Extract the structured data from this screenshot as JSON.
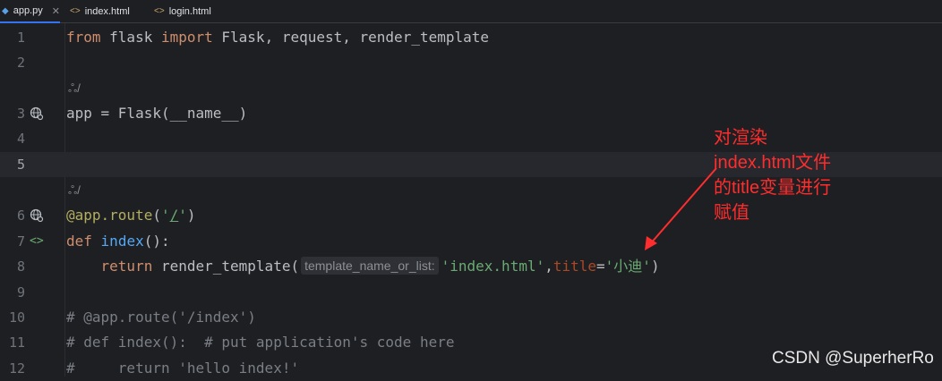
{
  "tabs": [
    {
      "label": "app.py",
      "icon": "python-file-icon",
      "active": true
    },
    {
      "label": "index.html",
      "icon": "html-file-icon"
    },
    {
      "label": "login.html",
      "icon": "html-file-icon"
    }
  ],
  "editor": {
    "lines": {
      "l1": {
        "num": "1",
        "code": "from flask import Flask, request, render_template"
      },
      "l2": {
        "num": "2"
      },
      "lens1": "ஃ/",
      "l3": {
        "num": "3",
        "code": "app = Flask(__name__)"
      },
      "l4": {
        "num": "4"
      },
      "l5": {
        "num": "5"
      },
      "lens2": "ஃ/",
      "l6": {
        "num": "6",
        "code": "@app.route('/')"
      },
      "l7": {
        "num": "7",
        "code": "def index():"
      },
      "l8": {
        "num": "8",
        "hint": "template_name_or_list:",
        "code": "return render_template('index.html',title='小迪')"
      },
      "l9": {
        "num": "9"
      },
      "l10": {
        "num": "10",
        "code": "# @app.route('/index')"
      },
      "l11": {
        "num": "11",
        "code": "# def index():  # put application's code here"
      },
      "l12": {
        "num": "12",
        "code": "#     return 'hello index!'"
      }
    },
    "current_line": 5
  },
  "annotation": {
    "text": "对渲染index.html文件的title变量进行赋值",
    "color": "#ff2d2d"
  },
  "watermark": "CSDN @SuperherRo",
  "colors": {
    "keyword": "#cf8e6d",
    "function": "#56a8f5",
    "string": "#6aab73",
    "decorator": "#b3ae60",
    "comment": "#7a7e85",
    "accent": "#3574f0"
  }
}
